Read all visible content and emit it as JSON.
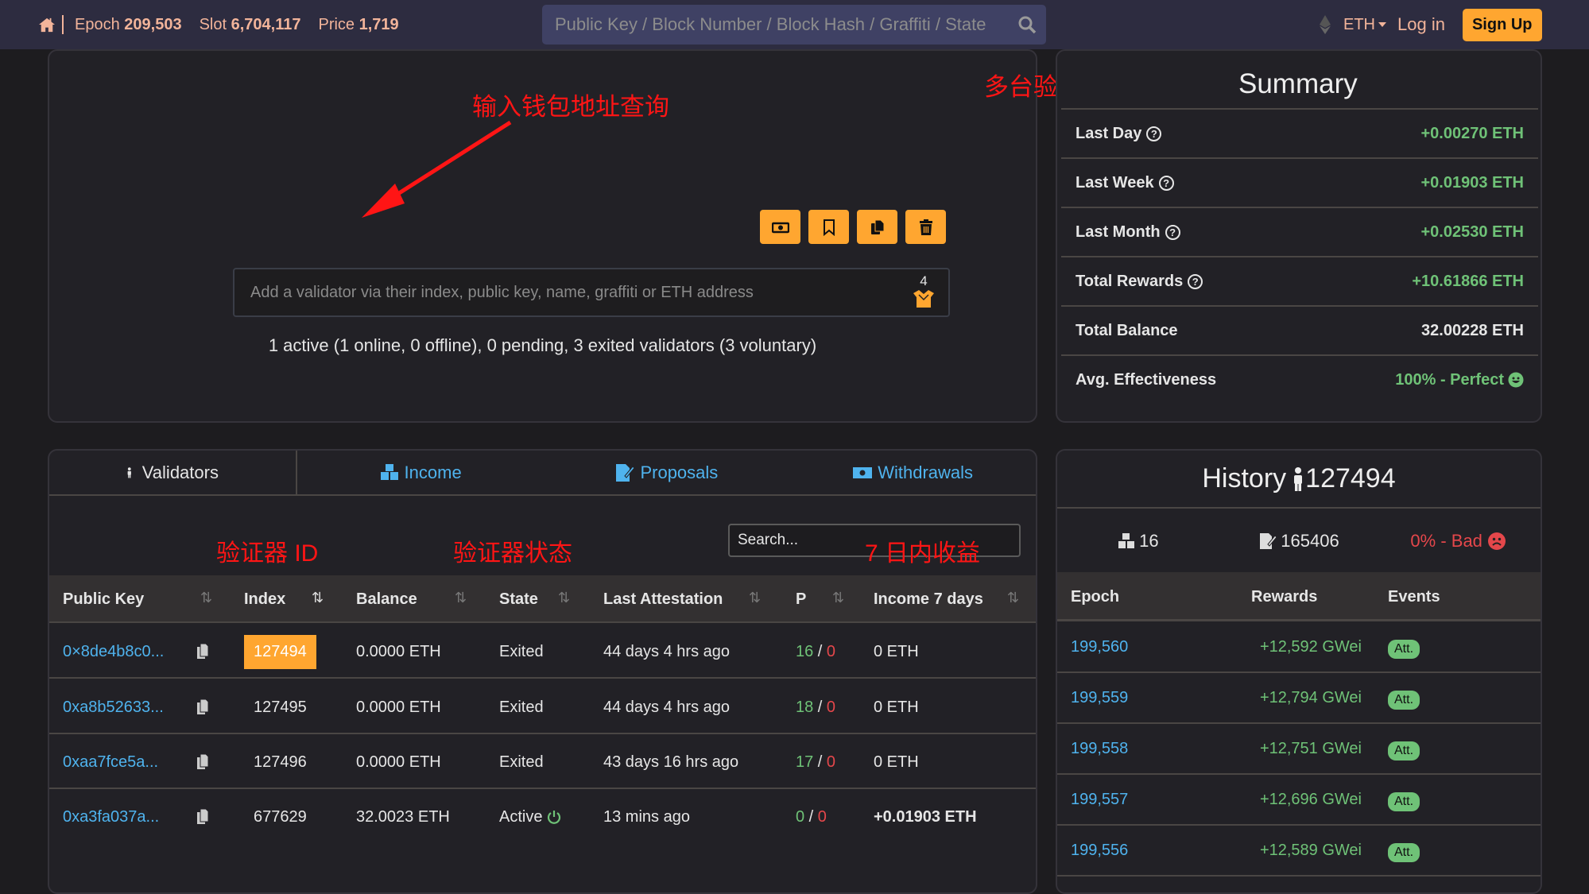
{
  "topbar": {
    "epoch_label": "Epoch",
    "epoch_value": "209,503",
    "slot_label": "Slot",
    "slot_value": "6,704,117",
    "price_label": "Price",
    "price_value": "1,719",
    "search_placeholder": "Public Key / Block Number / Block Hash / Graffiti / State",
    "currency": "ETH",
    "login": "Log in",
    "signup": "Sign Up"
  },
  "dashboard": {
    "annotation_input": "输入钱包地址查询",
    "annotation_summary": "多台验证器合计收益",
    "input_placeholder": "Add a validator via their index, public key, name, graffiti or ETH address",
    "validator_count": "4",
    "status_summary": "1 active (1 online, 0 offline), 0 pending, 3 exited validators (3 voluntary)",
    "toolbar_icons": [
      "money-bill-icon",
      "bookmark-icon",
      "copy-icon",
      "trash-icon"
    ]
  },
  "summary": {
    "title": "Summary",
    "rows": [
      {
        "label": "Last Day",
        "value": "+0.00270 ETH",
        "help": true,
        "color": "green"
      },
      {
        "label": "Last Week",
        "value": "+0.01903 ETH",
        "help": true,
        "color": "green"
      },
      {
        "label": "Last Month",
        "value": "+0.02530 ETH",
        "help": true,
        "color": "green"
      },
      {
        "label": "Total Rewards",
        "value": "+10.61866 ETH",
        "help": true,
        "color": "green"
      },
      {
        "label": "Total Balance",
        "value": "32.00228 ETH",
        "help": false,
        "color": "white"
      },
      {
        "label": "Avg. Effectiveness",
        "value": "100% - Perfect",
        "help": false,
        "color": "green"
      }
    ]
  },
  "tabs": [
    {
      "label": "Validators",
      "active": true
    },
    {
      "label": "Income",
      "active": false
    },
    {
      "label": "Proposals",
      "active": false
    },
    {
      "label": "Withdrawals",
      "active": false
    }
  ],
  "table": {
    "annotation_id": "验证器 ID",
    "annotation_state": "验证器状态",
    "annotation_income": "7 日内收益",
    "search_placeholder": "Search...",
    "columns": [
      "Public Key",
      "Index",
      "Balance",
      "State",
      "Last Attestation",
      "P",
      "Income 7 days"
    ],
    "sorted_column": "Index",
    "rows": [
      {
        "pubkey": "0×8de4b8c0...",
        "index": "127494",
        "balance": "0.0000 ETH",
        "state": "Exited",
        "last_att": "44 days 4 hrs ago",
        "p_ok": "16",
        "p_miss": "0",
        "income": "0 ETH",
        "highlight": true
      },
      {
        "pubkey": "0xa8b52633...",
        "index": "127495",
        "balance": "0.0000 ETH",
        "state": "Exited",
        "last_att": "44 days 4 hrs ago",
        "p_ok": "18",
        "p_miss": "0",
        "income": "0 ETH"
      },
      {
        "pubkey": "0xaa7fce5a...",
        "index": "127496",
        "balance": "0.0000 ETH",
        "state": "Exited",
        "last_att": "43 days 16 hrs ago",
        "p_ok": "17",
        "p_miss": "0",
        "income": "0 ETH"
      },
      {
        "pubkey": "0xa3fa037a...",
        "index": "677629",
        "balance": "32.0023 ETH",
        "state": "Active",
        "last_att": "13 mins ago",
        "p_ok": "0",
        "p_miss": "0",
        "income": "+0.01903 ETH",
        "online": true
      }
    ]
  },
  "history": {
    "title": "History",
    "validator": "127494",
    "blocks": "16",
    "attestations": "165406",
    "effectiveness": "0% - Bad",
    "columns": [
      "Epoch",
      "Rewards",
      "Events"
    ],
    "rows": [
      {
        "epoch": "199,560",
        "reward": "+12,592 GWei",
        "event": "Att."
      },
      {
        "epoch": "199,559",
        "reward": "+12,794 GWei",
        "event": "Att."
      },
      {
        "epoch": "199,558",
        "reward": "+12,751 GWei",
        "event": "Att."
      },
      {
        "epoch": "199,557",
        "reward": "+12,696 GWei",
        "event": "Att."
      },
      {
        "epoch": "199,556",
        "reward": "+12,589 GWei",
        "event": "Att."
      }
    ]
  }
}
